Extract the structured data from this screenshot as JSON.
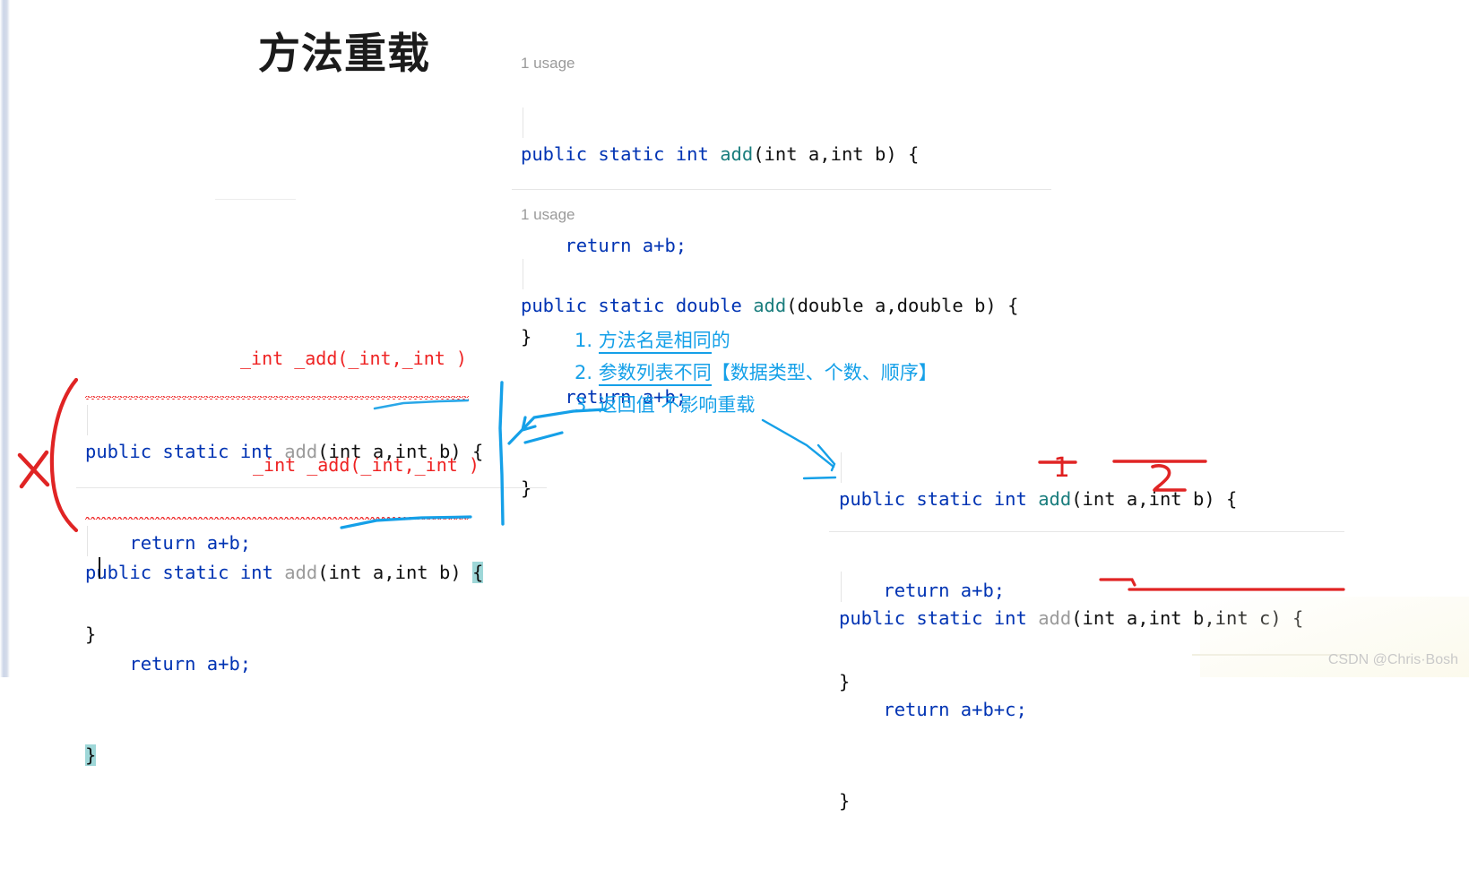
{
  "page": {
    "title": "方法重载",
    "watermark": "CSDN @Chris·Bosh"
  },
  "code_blocks": {
    "top1": {
      "usage": "1 usage",
      "line1_kw_public": "public",
      "line1_kw_static": "static",
      "line1_type": "int",
      "line1_method": "add",
      "line1_params": "(int a,int b) {",
      "line2": "    return a+b;",
      "line3": "}"
    },
    "top2": {
      "usage": "1 usage",
      "line1_kw_public": "public",
      "line1_kw_static": "static",
      "line1_type": "double",
      "line1_method": "add",
      "line1_params": "(double a,double b) {",
      "line2": "    return a+b;",
      "line3": "}"
    },
    "left1": {
      "red_label": "_int _add(_int,_int )",
      "line1_kw_public": "public",
      "line1_kw_static": "static",
      "line1_type": "int",
      "line1_method": "add",
      "line1_params": "(int a,int b) {",
      "line2": "    return a+b;",
      "line3": "}"
    },
    "left2": {
      "red_label": "_int _add(_int,_int )",
      "line1_kw_public": "public",
      "line1_kw_static": "static",
      "line1_type": "int",
      "line1_method": "add",
      "line1_params": "(int a,int b) ",
      "line1_brace": "{",
      "line2": "    return a+b;",
      "line3": "}"
    },
    "right1": {
      "line1_kw_public": "public",
      "line1_kw_static": "static",
      "line1_type": "int",
      "line1_method": "add",
      "line1_params": "(int a,int b) {",
      "line2": "    return a+b;",
      "line3": "}",
      "mark_one": "1",
      "mark_two": "2"
    },
    "right2": {
      "line1_kw_public": "public",
      "line1_kw_static": "static",
      "line1_type": "int",
      "line1_method": "add",
      "line1_params": "(int a,int b,int c) {",
      "line2": "    return a+b+c;",
      "line3": "}"
    }
  },
  "annotations": {
    "item1_num": "1.",
    "item1_underlined": "方法名是相同",
    "item1_rest": "的",
    "item2_num": "2.",
    "item2_underlined": "参数列表不同",
    "item2_rest": "【数据类型、个数、顺序】",
    "item3_num": "3.",
    "item3_text": "返回值 不影响重载"
  },
  "colors": {
    "keyword_blue": "#0033b3",
    "method_teal": "#1a7d7d",
    "method_grey": "#9b9b9b",
    "annotation_cyan": "#15a0e8",
    "pen_red": "#ee2222",
    "bracket_highlight": "#9ed7d8",
    "usage_grey": "#9a9a9a"
  }
}
